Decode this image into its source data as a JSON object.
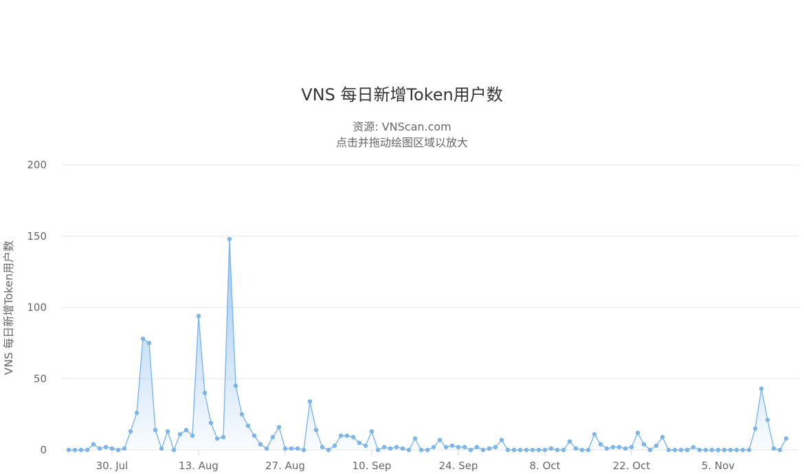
{
  "title": "VNS 每日新增Token用户数",
  "subtitle_lines": [
    "资源: VNScan.com",
    "点击并拖动绘图区域以放大"
  ],
  "chart_data": {
    "type": "area",
    "title": "VNS 每日新增Token用户数",
    "ylabel": "VNS 每日新增Token用户数",
    "xlabel": "",
    "ylim": [
      0,
      200
    ],
    "yticks": [
      0,
      50,
      100,
      150,
      200
    ],
    "grid": true,
    "legend": "none",
    "x_start": "2020-07-23",
    "x_end": "2020-11-11",
    "xticks": [
      {
        "date": "2020-07-30",
        "label": "30. Jul"
      },
      {
        "date": "2020-08-13",
        "label": "13. Aug"
      },
      {
        "date": "2020-08-27",
        "label": "27. Aug"
      },
      {
        "date": "2020-09-10",
        "label": "10. Sep"
      },
      {
        "date": "2020-09-24",
        "label": "24. Sep"
      },
      {
        "date": "2020-10-08",
        "label": "8. Oct"
      },
      {
        "date": "2020-10-22",
        "label": "22. Oct"
      },
      {
        "date": "2020-11-05",
        "label": "5. Nov"
      }
    ],
    "series": [
      {
        "color": "#7cb5ec",
        "values": [
          0,
          0,
          0,
          0,
          4,
          1,
          2,
          1,
          0,
          1,
          13,
          26,
          78,
          75,
          14,
          1,
          13,
          0,
          11,
          14,
          10,
          94,
          40,
          19,
          8,
          9,
          148,
          45,
          25,
          17,
          10,
          4,
          1,
          9,
          16,
          1,
          1,
          1,
          0,
          34,
          14,
          2,
          0,
          3,
          10,
          10,
          9,
          5,
          3,
          13,
          0,
          2,
          1,
          2,
          1,
          0,
          8,
          0,
          0,
          2,
          7,
          2,
          3,
          2,
          2,
          0,
          2,
          0,
          1,
          2,
          7,
          0,
          0,
          0,
          0,
          0,
          0,
          0,
          1,
          0,
          0,
          6,
          1,
          0,
          0,
          11,
          4,
          1,
          2,
          2,
          1,
          2,
          12,
          4,
          0,
          3,
          9,
          0,
          0,
          0,
          0,
          2,
          0,
          0,
          0,
          0,
          0,
          0,
          0,
          0,
          0,
          15,
          43,
          21,
          1,
          0,
          8
        ]
      }
    ]
  }
}
